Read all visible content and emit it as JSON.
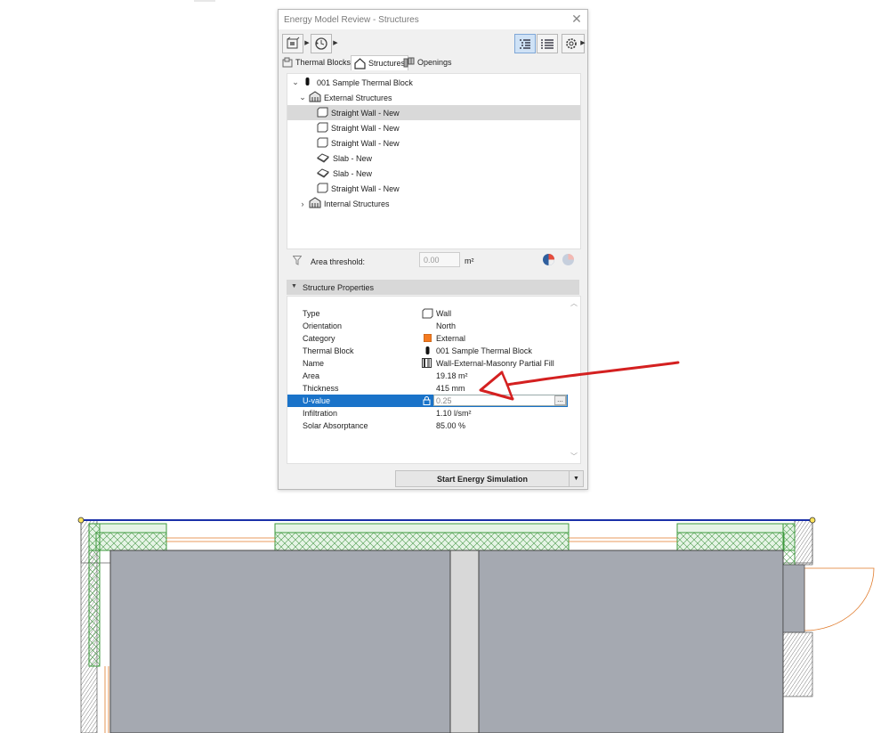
{
  "window": {
    "title": "Energy Model Review - Structures",
    "close_glyph": "✕"
  },
  "tabs": [
    {
      "label": "Thermal Blocks",
      "icon": "thermal-blocks-icon"
    },
    {
      "label": "Structures",
      "icon": "structures-icon",
      "active": true
    },
    {
      "label": "Openings",
      "icon": "openings-icon"
    }
  ],
  "tree": {
    "root": {
      "label": "001 Sample Thermal Block",
      "expanded": true
    },
    "external": {
      "label": "External Structures",
      "expanded": true
    },
    "items": [
      {
        "label": "Straight Wall - New",
        "icon": "wall-icon",
        "selected": true
      },
      {
        "label": "Straight Wall - New",
        "icon": "wall-icon"
      },
      {
        "label": "Straight Wall - New",
        "icon": "wall-icon"
      },
      {
        "label": "Slab - New",
        "icon": "slab-icon"
      },
      {
        "label": "Slab - New",
        "icon": "slab-icon"
      },
      {
        "label": "Straight Wall - New",
        "icon": "wall-icon"
      }
    ],
    "internal": {
      "label": "Internal Structures",
      "expanded": false
    }
  },
  "area_threshold": {
    "label": "Area threshold:",
    "value": "0.00",
    "unit": "m²"
  },
  "properties": {
    "title": "Structure Properties",
    "rows": [
      {
        "name": "Type",
        "value": "Wall",
        "icon": "wall-icon"
      },
      {
        "name": "Orientation",
        "value": "North"
      },
      {
        "name": "Category",
        "value": "External",
        "swatch": "#f47a20"
      },
      {
        "name": "Thermal Block",
        "value": "001 Sample Thermal Block",
        "icon": "thermal-block-icon"
      },
      {
        "name": "Name",
        "value": "Wall-External-Masonry Partial Fill",
        "icon": "composite-icon"
      },
      {
        "name": "Area",
        "value": "19.18 m²"
      },
      {
        "name": "Thickness",
        "value": "415 mm"
      },
      {
        "name": "U-value",
        "value": "0.25",
        "icon": "lock-icon",
        "editing": true,
        "button": "..."
      },
      {
        "name": "Infiltration",
        "value": "1.10 l/sm²"
      },
      {
        "name": "Solar Absorptance",
        "value": "85.00 %"
      }
    ]
  },
  "start_button": {
    "label": "Start Energy Simulation"
  },
  "colors": {
    "selection": "#1a73c9",
    "annotation": "#d42020",
    "external_swatch": "#f47a20",
    "fill": "#a5a9b1"
  }
}
